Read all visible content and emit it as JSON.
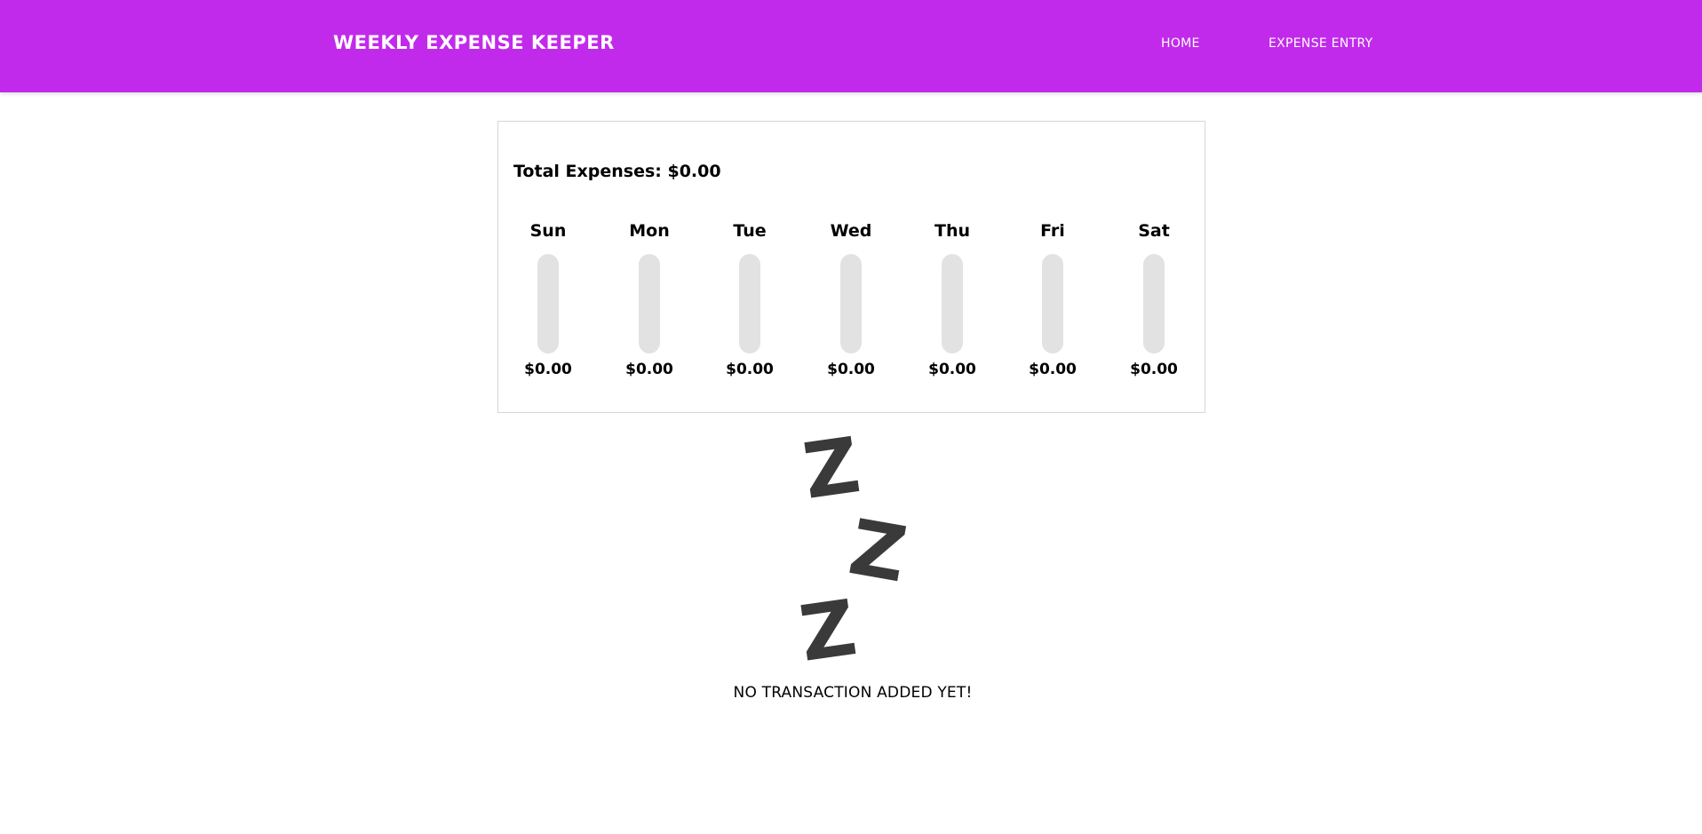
{
  "navbar": {
    "brand": "WEEKLY EXPENSE KEEPER",
    "links": [
      {
        "label": "HOME"
      },
      {
        "label": "EXPENSE ENTRY"
      }
    ],
    "color": "#c12aeb"
  },
  "summary": {
    "total_label": "Total Expenses: $0.00"
  },
  "days": [
    {
      "label": "Sun",
      "amount": "$0.00",
      "fill_fraction": 0
    },
    {
      "label": "Mon",
      "amount": "$0.00",
      "fill_fraction": 0
    },
    {
      "label": "Tue",
      "amount": "$0.00",
      "fill_fraction": 0
    },
    {
      "label": "Wed",
      "amount": "$0.00",
      "fill_fraction": 0
    },
    {
      "label": "Thu",
      "amount": "$0.00",
      "fill_fraction": 0
    },
    {
      "label": "Fri",
      "amount": "$0.00",
      "fill_fraction": 0
    },
    {
      "label": "Sat",
      "amount": "$0.00",
      "fill_fraction": 0
    }
  ],
  "empty_state": {
    "icon": "sleeping-zzz-icon",
    "glyphs": [
      "Z",
      "Z",
      "Z"
    ],
    "message": "NO TRANSACTION ADDED YET!"
  },
  "colors": {
    "accent": "#c12aeb",
    "bar_track": "#e2e2e2",
    "zzz": "#3a3a3a"
  }
}
